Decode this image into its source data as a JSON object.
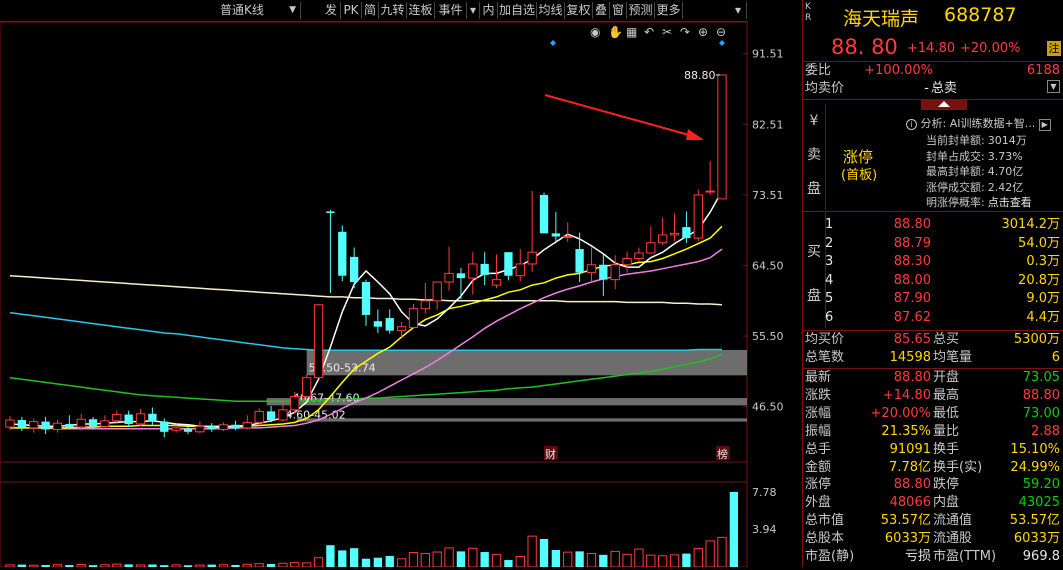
{
  "toolbar": {
    "period": "普通K线",
    "buttons": [
      "发",
      "PK",
      "简",
      "九转",
      "连板",
      "事件",
      "内",
      "加自选",
      "均线",
      "复权",
      "叠",
      "窗",
      "预测",
      "更多"
    ]
  },
  "chart_data": {
    "type": "candlestick",
    "price_ticks": [
      "91.51",
      "82.51",
      "73.51",
      "64.50",
      "55.50",
      "46.50"
    ],
    "volume_ticks": [
      "7.78",
      "3.94"
    ],
    "annotations": {
      "last_high": "88.80",
      "band1": "50.50-53.74",
      "band2": "46.67-47.60",
      "band3": "44.60-45.02",
      "cai_marker": "财",
      "bang_marker": "榜"
    },
    "candles": [
      {
        "o": 43.9,
        "c": 44.8,
        "h": 45.3,
        "l": 43.5
      },
      {
        "o": 44.8,
        "c": 43.8,
        "h": 45.2,
        "l": 43.4
      },
      {
        "o": 43.8,
        "c": 44.6,
        "h": 45.0,
        "l": 43.2
      },
      {
        "o": 44.6,
        "c": 43.6,
        "h": 45.2,
        "l": 43.0
      },
      {
        "o": 43.6,
        "c": 44.4,
        "h": 44.8,
        "l": 43.2
      },
      {
        "o": 44.3,
        "c": 43.9,
        "h": 45.4,
        "l": 43.6
      },
      {
        "o": 43.9,
        "c": 44.9,
        "h": 45.6,
        "l": 43.5
      },
      {
        "o": 44.9,
        "c": 44.0,
        "h": 45.2,
        "l": 43.6
      },
      {
        "o": 44.0,
        "c": 44.7,
        "h": 45.4,
        "l": 43.8
      },
      {
        "o": 44.7,
        "c": 45.5,
        "h": 46.0,
        "l": 44.3
      },
      {
        "o": 45.5,
        "c": 44.3,
        "h": 46.0,
        "l": 43.9
      },
      {
        "o": 44.3,
        "c": 45.6,
        "h": 46.2,
        "l": 44.0
      },
      {
        "o": 45.6,
        "c": 44.6,
        "h": 46.4,
        "l": 44.2
      },
      {
        "o": 44.6,
        "c": 43.3,
        "h": 45.0,
        "l": 42.6
      },
      {
        "o": 43.5,
        "c": 43.8,
        "h": 44.2,
        "l": 43.2
      },
      {
        "o": 43.7,
        "c": 43.3,
        "h": 44.1,
        "l": 43.0
      },
      {
        "o": 43.3,
        "c": 44.0,
        "h": 44.6,
        "l": 43.1
      },
      {
        "o": 44.0,
        "c": 43.6,
        "h": 44.4,
        "l": 43.3
      },
      {
        "o": 43.6,
        "c": 44.2,
        "h": 44.5,
        "l": 43.4
      },
      {
        "o": 44.2,
        "c": 43.7,
        "h": 44.7,
        "l": 43.5
      },
      {
        "o": 43.8,
        "c": 44.5,
        "h": 45.4,
        "l": 43.6
      },
      {
        "o": 44.5,
        "c": 45.9,
        "h": 46.3,
        "l": 44.2
      },
      {
        "o": 45.9,
        "c": 44.8,
        "h": 46.6,
        "l": 44.5
      },
      {
        "o": 44.8,
        "c": 46.1,
        "h": 47.1,
        "l": 44.6
      },
      {
        "o": 46.1,
        "c": 47.8,
        "h": 48.4,
        "l": 45.6
      },
      {
        "o": 47.8,
        "c": 50.2,
        "h": 50.6,
        "l": 47.6
      },
      {
        "o": 50.2,
        "c": 59.5,
        "h": 59.6,
        "l": 50.1
      },
      {
        "o": 71.4,
        "c": 71.2,
        "h": 71.6,
        "l": 61.0
      },
      {
        "o": 68.8,
        "c": 63.2,
        "h": 69.6,
        "l": 62.5
      },
      {
        "o": 65.6,
        "c": 62.4,
        "h": 66.8,
        "l": 61.6
      },
      {
        "o": 62.4,
        "c": 58.2,
        "h": 62.7,
        "l": 56.8
      },
      {
        "o": 57.4,
        "c": 56.7,
        "h": 58.9,
        "l": 55.9
      },
      {
        "o": 57.8,
        "c": 56.2,
        "h": 58.9,
        "l": 55.8
      },
      {
        "o": 56.2,
        "c": 56.7,
        "h": 57.3,
        "l": 55.4
      },
      {
        "o": 56.6,
        "c": 59.0,
        "h": 59.6,
        "l": 56.4
      },
      {
        "o": 59.0,
        "c": 60.0,
        "h": 62.3,
        "l": 58.4
      },
      {
        "o": 60.0,
        "c": 62.4,
        "h": 62.4,
        "l": 58.9
      },
      {
        "o": 62.4,
        "c": 63.5,
        "h": 66.9,
        "l": 61.3
      },
      {
        "o": 63.5,
        "c": 62.9,
        "h": 64.2,
        "l": 60.2
      },
      {
        "o": 62.9,
        "c": 64.7,
        "h": 66.2,
        "l": 60.8
      },
      {
        "o": 64.7,
        "c": 63.3,
        "h": 66.2,
        "l": 62.0
      },
      {
        "o": 62.0,
        "c": 62.7,
        "h": 65.9,
        "l": 61.6
      },
      {
        "o": 66.2,
        "c": 63.2,
        "h": 66.2,
        "l": 62.6
      },
      {
        "o": 63.2,
        "c": 64.7,
        "h": 66.6,
        "l": 62.5
      },
      {
        "o": 64.7,
        "c": 66.2,
        "h": 74.0,
        "l": 63.7
      },
      {
        "o": 73.5,
        "c": 68.6,
        "h": 73.8,
        "l": 68.6
      },
      {
        "o": 68.6,
        "c": 68.2,
        "h": 71.3,
        "l": 67.6
      },
      {
        "o": 68.2,
        "c": 68.2,
        "h": 70.0,
        "l": 67.5
      },
      {
        "o": 66.6,
        "c": 63.6,
        "h": 68.7,
        "l": 62.4
      },
      {
        "o": 63.6,
        "c": 64.6,
        "h": 66.8,
        "l": 62.4
      },
      {
        "o": 64.6,
        "c": 62.7,
        "h": 65.9,
        "l": 60.6
      },
      {
        "o": 62.7,
        "c": 64.6,
        "h": 65.8,
        "l": 61.5
      },
      {
        "o": 64.6,
        "c": 65.4,
        "h": 66.3,
        "l": 63.6
      },
      {
        "o": 65.4,
        "c": 66.1,
        "h": 66.8,
        "l": 65.0
      },
      {
        "o": 66.1,
        "c": 67.4,
        "h": 69.5,
        "l": 66.0
      },
      {
        "o": 67.4,
        "c": 68.4,
        "h": 70.6,
        "l": 67.1
      },
      {
        "o": 68.4,
        "c": 68.6,
        "h": 71.1,
        "l": 67.6
      },
      {
        "o": 69.4,
        "c": 68.0,
        "h": 71.4,
        "l": 67.4
      },
      {
        "o": 68.0,
        "c": 73.5,
        "h": 74.2,
        "l": 67.6
      },
      {
        "o": 74.0,
        "c": 74.0,
        "h": 77.8,
        "l": 73.5
      },
      {
        "o": 73.0,
        "c": 88.8,
        "h": 88.8,
        "l": 73.0
      }
    ],
    "volumes": [
      0.22,
      0.25,
      0.18,
      0.21,
      0.24,
      0.2,
      0.26,
      0.19,
      0.23,
      0.3,
      0.27,
      0.21,
      0.26,
      0.19,
      0.22,
      0.18,
      0.2,
      0.25,
      0.23,
      0.21,
      0.28,
      0.34,
      0.31,
      0.39,
      0.45,
      0.42,
      0.96,
      2.26,
      1.72,
      1.95,
      0.86,
      0.96,
      1.14,
      0.85,
      1.5,
      1.4,
      1.55,
      1.98,
      1.62,
      1.94,
      1.55,
      1.31,
      0.72,
      1.08,
      3.2,
      2.9,
      1.76,
      1.54,
      1.62,
      1.39,
      1.26,
      1.62,
      1.31,
      1.86,
      1.23,
      1.16,
      1.26,
      1.39,
      1.91,
      2.7,
      3.07,
      7.78
    ],
    "ma_lines": {
      "white": [
        44.3,
        44.2,
        44.1,
        44.0,
        44.0,
        44.1,
        44.3,
        44.3,
        44.4,
        44.5,
        44.6,
        44.6,
        44.7,
        44.5,
        44.3,
        44.2,
        44.0,
        43.9,
        43.9,
        44.0,
        44.1,
        44.4,
        44.7,
        45.1,
        45.8,
        47.1,
        50.0,
        54.1,
        58.6,
        62.1,
        63.8,
        62.4,
        60.9,
        58.6,
        57.1,
        56.8,
        57.7,
        59.1,
        60.6,
        62.6,
        63.5,
        63.5,
        64.0,
        64.5,
        65.3,
        66.5,
        67.5,
        68.5,
        67.9,
        67.0,
        66.0,
        64.8,
        64.3,
        64.3,
        65.5,
        66.2,
        67.3,
        68.2,
        69.1,
        71.3,
        74.0
      ],
      "yellow": [
        43.8,
        43.8,
        43.8,
        43.8,
        43.8,
        43.8,
        43.9,
        43.9,
        44.0,
        44.0,
        44.0,
        44.1,
        44.1,
        44.1,
        44.1,
        44.0,
        44.0,
        44.0,
        44.0,
        44.0,
        44.0,
        44.1,
        44.2,
        44.3,
        44.5,
        45.0,
        46.1,
        47.8,
        49.6,
        51.3,
        52.3,
        53.3,
        54.1,
        55.4,
        56.6,
        57.6,
        58.2,
        59.0,
        59.3,
        59.7,
        60.1,
        60.5,
        61.1,
        61.4,
        62.0,
        62.3,
        62.9,
        63.3,
        63.5,
        64.0,
        64.4,
        64.6,
        64.6,
        64.9,
        65.0,
        65.4,
        66.0,
        66.6,
        67.3,
        68.0,
        69.5
      ],
      "pink": [
        43.8,
        43.8,
        43.8,
        43.8,
        43.7,
        43.7,
        43.7,
        43.7,
        43.7,
        43.7,
        43.7,
        43.7,
        43.7,
        43.7,
        43.7,
        43.7,
        43.7,
        43.7,
        43.7,
        43.8,
        43.8,
        43.8,
        43.9,
        44.0,
        44.1,
        44.4,
        44.8,
        45.5,
        46.3,
        47.0,
        47.6,
        48.3,
        49.1,
        49.9,
        50.7,
        51.5,
        52.4,
        53.4,
        54.4,
        55.4,
        56.5,
        57.4,
        58.2,
        59.0,
        59.7,
        60.4,
        61.0,
        61.5,
        61.9,
        62.4,
        62.8,
        63.1,
        63.4,
        63.6,
        63.8,
        64.1,
        64.4,
        64.7,
        65.0,
        65.5,
        66.6
      ],
      "beige": [
        63.2,
        63.1,
        63.0,
        62.9,
        62.8,
        62.7,
        62.6,
        62.5,
        62.4,
        62.3,
        62.2,
        62.1,
        62.0,
        61.9,
        61.8,
        61.7,
        61.6,
        61.5,
        61.4,
        61.3,
        61.2,
        61.1,
        61.0,
        60.9,
        60.8,
        60.7,
        60.6,
        60.5,
        60.5,
        60.4,
        60.4,
        60.3,
        60.3,
        60.2,
        60.2,
        60.1,
        60.1,
        60.0,
        60.0,
        60.0,
        60.0,
        60.0,
        60.0,
        60.0,
        60.0,
        60.0,
        60.0,
        59.9,
        59.9,
        59.9,
        59.9,
        59.9,
        59.8,
        59.8,
        59.8,
        59.8,
        59.7,
        59.7,
        59.6,
        59.6,
        59.5
      ],
      "cyan": [
        58.5,
        58.3,
        58.1,
        57.9,
        57.7,
        57.5,
        57.3,
        57.1,
        56.9,
        56.7,
        56.5,
        56.3,
        56.1,
        55.9,
        55.8,
        55.6,
        55.4,
        55.2,
        55.0,
        54.8,
        54.6,
        54.4,
        54.2,
        54.0,
        53.9,
        53.8,
        53.7,
        53.7,
        53.7,
        53.7,
        53.7,
        53.7,
        53.7,
        53.7,
        53.7,
        53.7,
        53.7,
        53.7,
        53.7,
        53.7,
        53.7,
        53.7,
        53.7,
        53.7,
        53.7,
        53.7,
        53.7,
        53.7,
        53.7,
        53.7,
        53.7,
        53.7,
        53.7,
        53.7,
        53.7,
        53.7,
        53.7,
        53.7,
        53.8,
        53.8,
        53.8
      ],
      "green": [
        50.2,
        50.0,
        49.8,
        49.6,
        49.4,
        49.2,
        49.0,
        48.8,
        48.6,
        48.4,
        48.2,
        48.0,
        47.9,
        47.8,
        47.7,
        47.6,
        47.5,
        47.4,
        47.3,
        47.2,
        47.2,
        47.2,
        47.2,
        47.2,
        47.2,
        47.3,
        47.3,
        47.4,
        47.4,
        47.5,
        47.6,
        47.6,
        47.7,
        47.8,
        47.9,
        48.0,
        48.1,
        48.2,
        48.3,
        48.4,
        48.5,
        48.6,
        48.8,
        48.9,
        49.0,
        49.2,
        49.4,
        49.6,
        49.8,
        50.0,
        50.2,
        50.4,
        50.6,
        50.8,
        51.0,
        51.3,
        51.6,
        51.9,
        52.2,
        52.6,
        53.2
      ]
    }
  },
  "side": {
    "kr": "K R",
    "name": "海天瑞声",
    "code": "688787",
    "price": "88. 80",
    "change": "+14.80",
    "pct": "+20.00%",
    "zhu": "注",
    "webi_label": "委比",
    "webi_pct": "+100.00%",
    "webi_val": "6188",
    "avgsell_label": "均卖价",
    "avgsell_val": "-",
    "totalsell_label": "总卖",
    "sell_chars": [
      "¥",
      "卖",
      "盘"
    ],
    "zt": "涨停",
    "zt_sub": "(首板)",
    "analysis_label": "分析:",
    "analysis_text": "AI训练数据+智...",
    "info": [
      {
        "k": "当前封单额:",
        "v": "3014万"
      },
      {
        "k": "封单占成交:",
        "v": "3.73%"
      },
      {
        "k": "最高封单额:",
        "v": "4.70亿"
      },
      {
        "k": "涨停成交额:",
        "v": "2.42亿"
      },
      {
        "k": "明涨停概率:",
        "v": "点击查看"
      }
    ],
    "buy_chars": [
      "买",
      "盘"
    ],
    "bids": [
      {
        "n": "1",
        "p": "88.80",
        "v": "3014.2万"
      },
      {
        "n": "2",
        "p": "88.79",
        "v": "54.0万"
      },
      {
        "n": "3",
        "p": "88.30",
        "v": "0.3万"
      },
      {
        "n": "4",
        "p": "88.00",
        "v": "20.8万"
      },
      {
        "n": "5",
        "p": "87.90",
        "v": "9.0万"
      },
      {
        "n": "6",
        "p": "87.62",
        "v": "4.4万"
      }
    ],
    "avgbuy_label": "均买价",
    "avgbuy_val": "85.65",
    "totalbuy_label": "总买",
    "totalbuy_val": "5300万",
    "deals_label": "总笔数",
    "deals_val": "14598",
    "avgdeal_label": "均笔量",
    "avgdeal_val": "6",
    "stats": [
      {
        "l1": "最新",
        "v1": "88.80",
        "c1": "red",
        "l2": "开盘",
        "v2": "73.05",
        "c2": "grn"
      },
      {
        "l1": "涨跌",
        "v1": "+14.80",
        "c1": "red",
        "l2": "最高",
        "v2": "88.80",
        "c2": "red"
      },
      {
        "l1": "涨幅",
        "v1": "+20.00%",
        "c1": "red",
        "l2": "最低",
        "v2": "73.00",
        "c2": "grn"
      },
      {
        "l1": "振幅",
        "v1": "21.35%",
        "c1": "yel",
        "l2": "量比",
        "v2": "2.88",
        "c2": "red"
      },
      {
        "l1": "总手",
        "v1": "91091",
        "c1": "yel",
        "l2": "换手",
        "v2": "15.10%",
        "c2": "yel"
      },
      {
        "l1": "金额",
        "v1": "7.78亿",
        "c1": "yel",
        "l2": "换手(实)",
        "v2": "24.99%",
        "c2": "yel"
      },
      {
        "l1": "涨停",
        "v1": "88.80",
        "c1": "red",
        "l2": "跌停",
        "v2": "59.20",
        "c2": "grn"
      },
      {
        "l1": "外盘",
        "v1": "48066",
        "c1": "red",
        "l2": "内盘",
        "v2": "43025",
        "c2": "grn"
      },
      {
        "l1": "总市值",
        "v1": "53.57亿",
        "c1": "yel",
        "l2": "流通值",
        "v2": "53.57亿",
        "c2": "yel"
      },
      {
        "l1": "总股本",
        "v1": "6033万",
        "c1": "yel",
        "l2": "流通股",
        "v2": "6033万",
        "c2": "yel"
      },
      {
        "l1": "市盈(静)",
        "v1": "亏损",
        "c1": "wht",
        "l2": "市盈(TTM)",
        "v2": "969.8",
        "c2": "wht"
      }
    ]
  }
}
